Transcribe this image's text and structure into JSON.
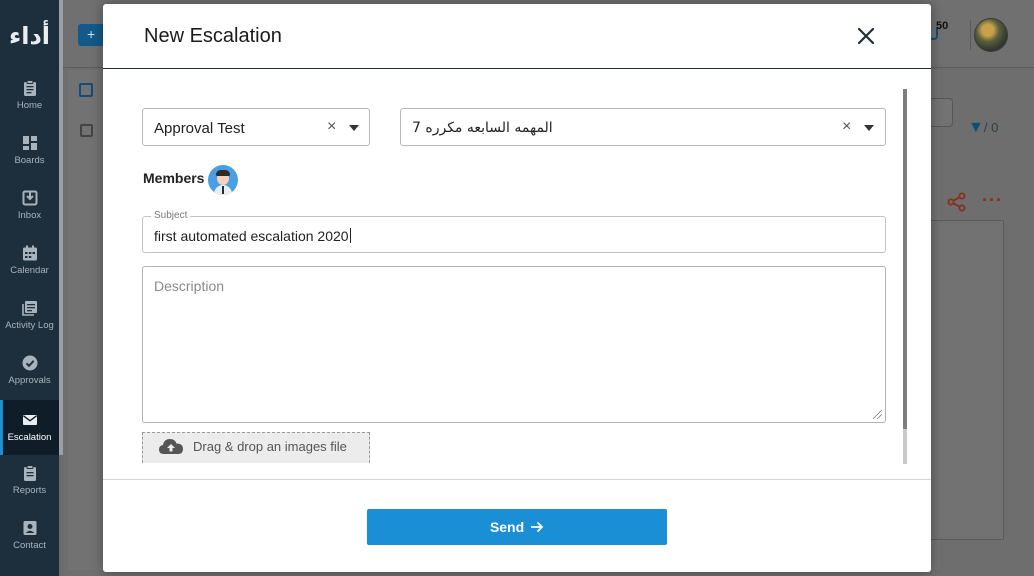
{
  "app": {
    "logo_text": "أداء"
  },
  "sidebar": {
    "items": [
      {
        "label": "Home",
        "icon": "clipboard-icon"
      },
      {
        "label": "Boards",
        "icon": "boards-icon"
      },
      {
        "label": "Inbox",
        "icon": "inbox-icon"
      },
      {
        "label": "Calendar",
        "icon": "calendar-icon"
      },
      {
        "label": "Activity Log",
        "icon": "activity-log-icon"
      },
      {
        "label": "Approvals",
        "icon": "check-circle-icon"
      },
      {
        "label": "Escalation",
        "icon": "envelope-icon",
        "active": true
      },
      {
        "label": "Reports",
        "icon": "reports-icon"
      },
      {
        "label": "Contact",
        "icon": "contact-card-icon"
      }
    ]
  },
  "background": {
    "add_button": "+",
    "notification_count": "50",
    "filter_count": "/ 0"
  },
  "modal": {
    "title": "New Escalation",
    "project_select": {
      "value": "Approval Test",
      "clear": "×"
    },
    "task_select": {
      "value": "المهمه السابعه مكرره 7",
      "clear": "×"
    },
    "members_label": "Members",
    "subject": {
      "legend": "Subject",
      "value": "first automated escalation 2020"
    },
    "description": {
      "placeholder": "Description"
    },
    "dropzone_text": "Drag & drop an images file",
    "send_label": "Send"
  },
  "colors": {
    "sidebar_bg": "#1d2f3d",
    "accent": "#1a8fd6",
    "overlay": "#6e6e6e"
  }
}
